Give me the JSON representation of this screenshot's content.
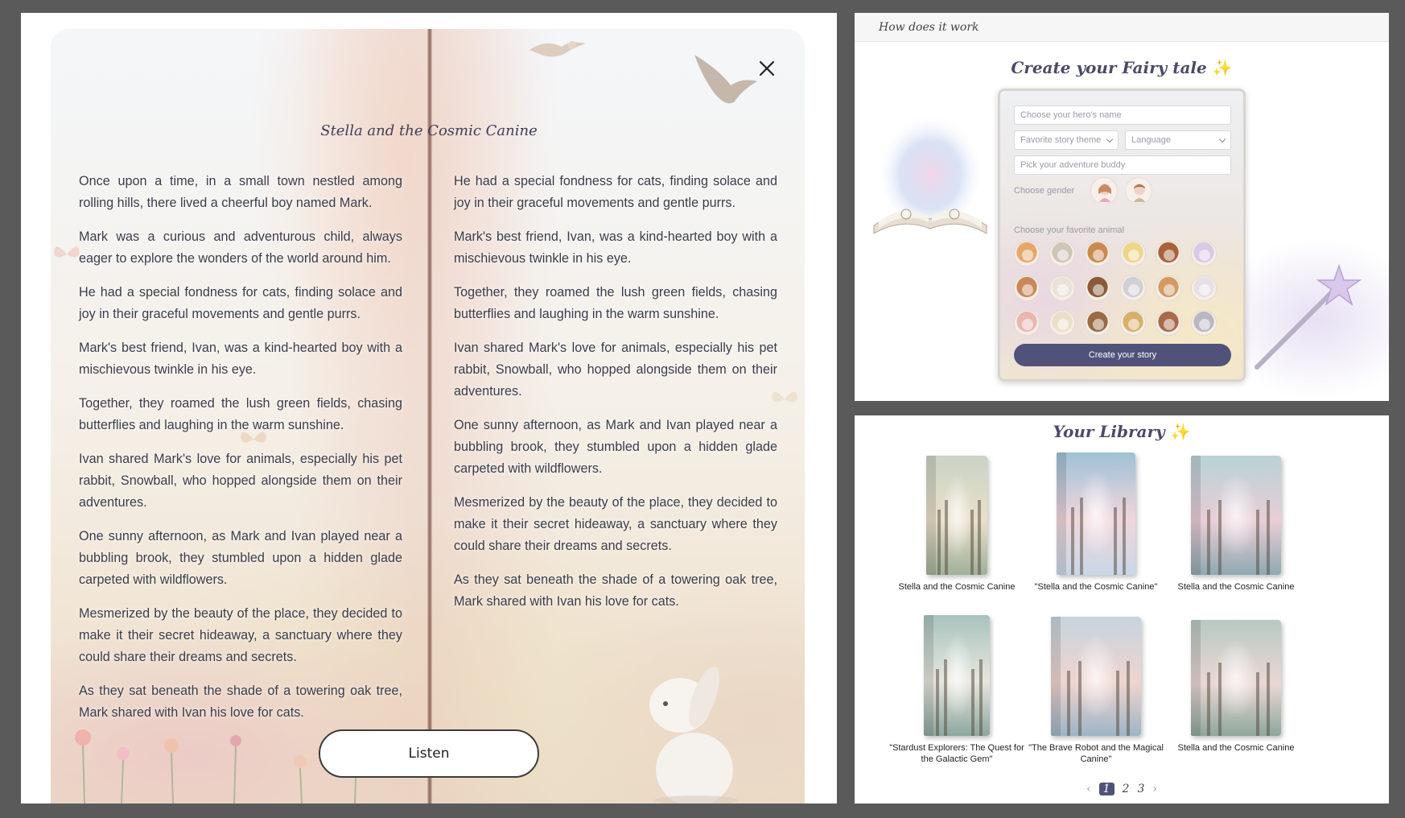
{
  "reader": {
    "title": "Stella and the Cosmic Canine",
    "close_icon": "close-icon",
    "left_column": [
      "Once upon a time, in a small town nestled among rolling hills, there lived a cheerful boy named Mark.",
      "Mark was a curious and adventurous child, always eager to explore the wonders of the world around him.",
      "He had a special fondness for cats, finding solace and joy in their graceful movements and gentle purrs.",
      "Mark's best friend, Ivan, was a kind-hearted boy with a mischievous twinkle in his eye.",
      "Together, they roamed the lush green fields, chasing butterflies and laughing in the warm sunshine.",
      "Ivan shared Mark's love for animals, especially his pet rabbit, Snowball, who hopped alongside them on their adventures.",
      "One sunny afternoon, as Mark and Ivan played near a bubbling brook, they stumbled upon a hidden glade carpeted with wildflowers.",
      "Mesmerized by the beauty of the place, they decided to make it their secret hideaway, a sanctuary where they could share their dreams and secrets.",
      "As they sat beneath the shade of a towering oak tree, Mark shared with Ivan his love for cats."
    ],
    "right_column": [
      "He had a special fondness for cats, finding solace and joy in their graceful movements and gentle purrs.",
      "Mark's best friend, Ivan, was a kind-hearted boy with a mischievous twinkle in his eye.",
      "Together, they roamed the lush green fields, chasing butterflies and laughing in the warm sunshine.",
      "Ivan shared Mark's love for animals, especially his pet rabbit, Snowball, who hopped alongside them on their adventures.",
      "One sunny afternoon, as Mark and Ivan played near a bubbling brook, they stumbled upon a hidden glade carpeted with wildflowers.",
      "Mesmerized by the beauty of the place, they decided to make it their secret hideaway, a sanctuary where they could share their dreams and secrets.",
      "As they sat beneath the shade of a towering oak tree, Mark shared with Ivan his love for cats."
    ],
    "listen_label": "Listen"
  },
  "how": {
    "header_label": "How does it work",
    "title": "Create your Fairy tale",
    "sparkle": "✨",
    "hero_placeholder": "Choose your hero's name",
    "theme_placeholder": "Favorite story theme",
    "language_placeholder": "Language",
    "buddy_placeholder": "Pick your adventure buddy",
    "gender_label": "Choose gender",
    "animal_label": "Choose your favorite animal",
    "animal_colors": [
      "#e6a86a",
      "#cfc6b6",
      "#c98a4e",
      "#efd58a",
      "#a8623a",
      "#d9c8e6",
      "#c9885a",
      "#e8e2d8",
      "#8a5a3a",
      "#cfcfd6",
      "#d49a62",
      "#e8dfe6",
      "#e9b7b0",
      "#eadfc8",
      "#9a6a44",
      "#d7b06a",
      "#a86a48",
      "#b8b8c2"
    ],
    "create_button": "Create your story"
  },
  "library": {
    "title": "Your Library",
    "sparkle": "✨",
    "books": [
      {
        "caption": "Stella and the Cosmic Canine",
        "colors": [
          "#c9d3c4",
          "#eadfc9",
          "#9fb09a"
        ]
      },
      {
        "caption": "\"Stella and the Cosmic Canine\"",
        "colors": [
          "#9ec1d6",
          "#f1d6dc",
          "#c8d7e6"
        ]
      },
      {
        "caption": "Stella and the Cosmic Canine",
        "colors": [
          "#b8d2d6",
          "#e9cdd6",
          "#8fa8b0"
        ]
      },
      {
        "caption": "\"Stardust Explorers: The Quest for the Galactic Gem\"",
        "colors": [
          "#a9c3bf",
          "#e6e6dc",
          "#8da79f"
        ]
      },
      {
        "caption": "\"The Brave Robot and the Magical Canine\"",
        "colors": [
          "#c6d4de",
          "#f0d4cf",
          "#9db5c6"
        ]
      },
      {
        "caption": "Stella and the Cosmic Canine",
        "colors": [
          "#b9c8c1",
          "#ead7d4",
          "#8ea79b"
        ]
      }
    ],
    "pager": {
      "prev": "‹",
      "pages": [
        "1",
        "2",
        "3"
      ],
      "active_page": "1",
      "next": "›"
    }
  }
}
